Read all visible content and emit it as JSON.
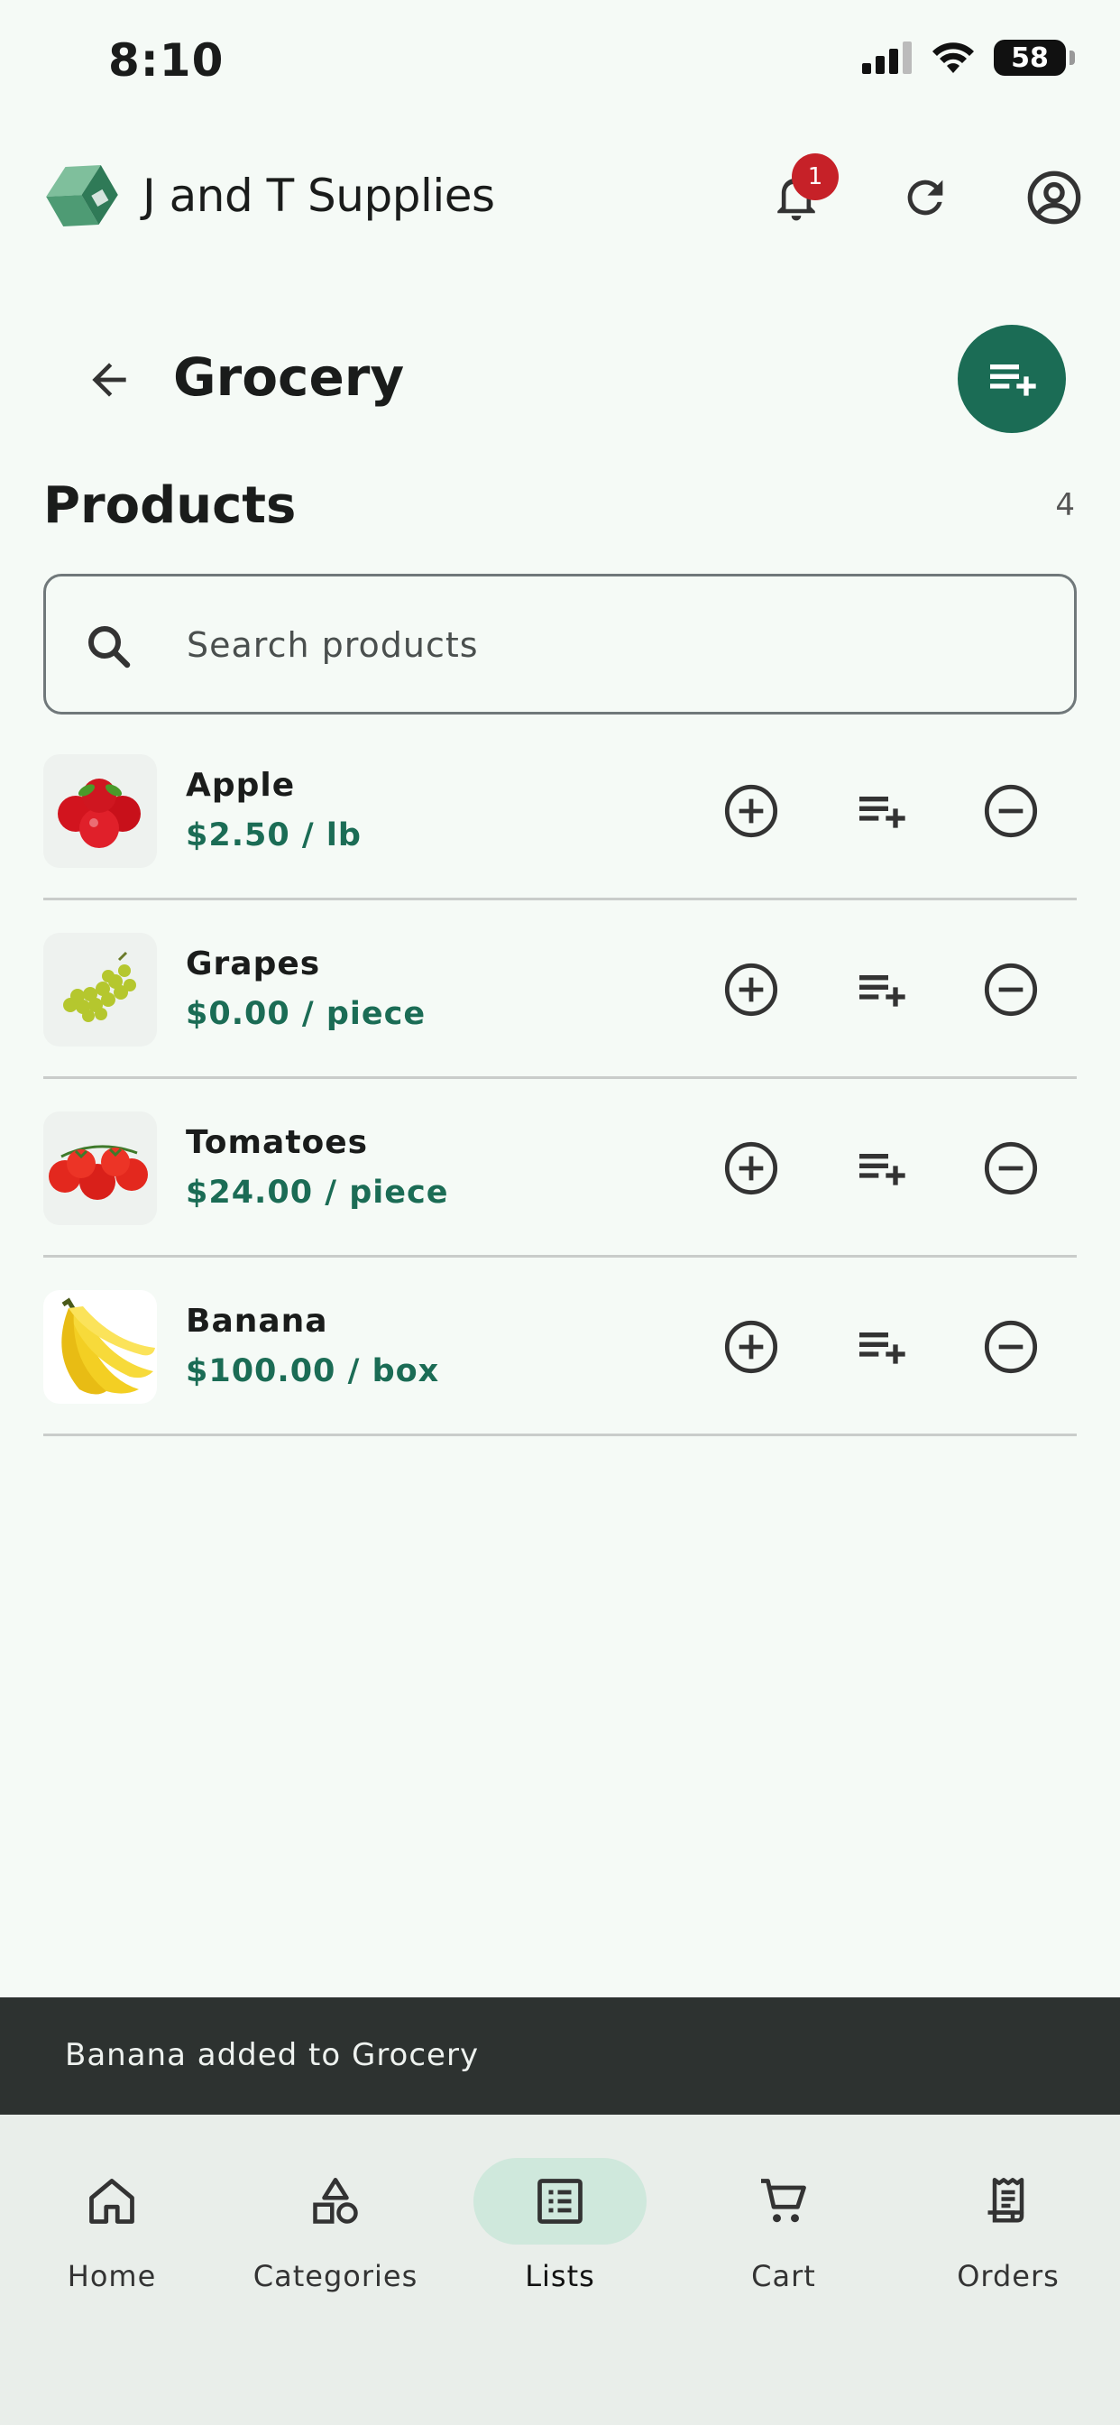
{
  "status_bar": {
    "time": "8:10",
    "battery": "58"
  },
  "app_bar": {
    "title": "J and T Supplies",
    "notification_count": "1"
  },
  "header": {
    "title": "Grocery"
  },
  "products_section": {
    "title": "Products",
    "count": "4"
  },
  "search": {
    "placeholder": "Search products",
    "value": ""
  },
  "products": [
    {
      "name": "Apple",
      "price": "$2.50 / lb"
    },
    {
      "name": "Grapes",
      "price": "$0.00 / piece"
    },
    {
      "name": "Tomatoes",
      "price": "$24.00 / piece"
    },
    {
      "name": "Banana",
      "price": "$100.00 / box"
    }
  ],
  "snackbar": {
    "message": "Banana added to Grocery"
  },
  "bottom_nav": {
    "active": "Lists",
    "items": [
      {
        "label": "Home",
        "icon": "home-icon"
      },
      {
        "label": "Categories",
        "icon": "shapes-icon"
      },
      {
        "label": "Lists",
        "icon": "list-alt-icon"
      },
      {
        "label": "Cart",
        "icon": "cart-icon"
      },
      {
        "label": "Orders",
        "icon": "receipt-icon"
      }
    ]
  },
  "colors": {
    "accent": "#1b6c55",
    "background": "#f5faf6",
    "badge": "#c62128",
    "snackbar": "#2d3230",
    "nav_background": "#e9eeea",
    "nav_active_pill": "#cfe8dc"
  }
}
